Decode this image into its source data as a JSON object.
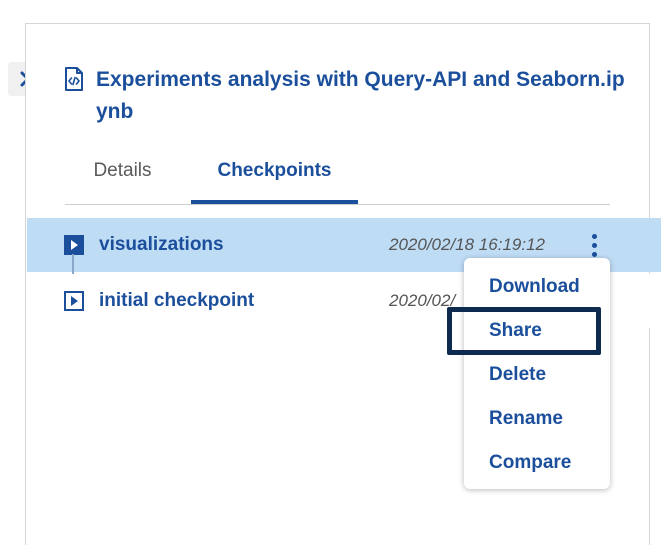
{
  "panel": {
    "file_title": "Experiments analysis with Query-API and Seaborn.ipynb"
  },
  "tabs": [
    {
      "label": "Details",
      "active": false
    },
    {
      "label": "Checkpoints",
      "active": true
    }
  ],
  "checkpoints": [
    {
      "name": "visualizations",
      "timestamp": "2020/02/18 16:19:12",
      "selected": true
    },
    {
      "name": "initial checkpoint",
      "timestamp": "2020/02/",
      "selected": false
    }
  ],
  "context_menu": {
    "items": [
      "Download",
      "Share",
      "Delete",
      "Rename",
      "Compare"
    ],
    "focused": "Share"
  },
  "colors": {
    "accent": "#1b4f9c",
    "selected_row": "#bfdcf5",
    "focus_border": "#0e2a4f"
  },
  "icons": {
    "collapse": "chevron-right-icon",
    "file": "notebook-file-icon",
    "checkpoint": "play-icon",
    "menu": "kebab-menu-icon"
  }
}
